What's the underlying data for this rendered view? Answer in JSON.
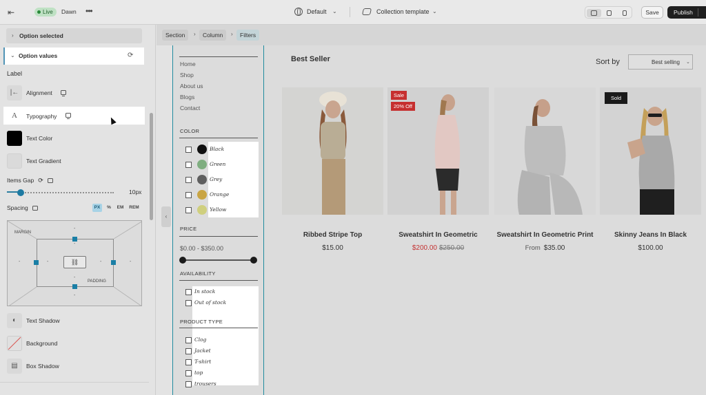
{
  "topbar": {
    "status_badge": "Live",
    "theme_name": "Dawn",
    "locale": "Default",
    "template": "Collection template",
    "save_label": "Save",
    "publish_label": "Publish",
    "icons": [
      "exit-icon",
      "more-icon",
      "globe-icon",
      "template-icon",
      "desktop-icon",
      "tablet-icon",
      "mobile-icon"
    ]
  },
  "sidebar": {
    "collapsed_section": "Option selected",
    "active_section": "Option values",
    "group_label": "Label",
    "properties": [
      {
        "label": "Alignment",
        "icon": "align-left-icon"
      },
      {
        "label": "Typography",
        "icon": "typography-icon"
      },
      {
        "label": "Text Color",
        "icon": "color-swatch"
      },
      {
        "label": "Text Gradient",
        "icon": "gradient-swatch"
      }
    ],
    "items_gap": {
      "label": "Items Gap",
      "value": "10px",
      "level": 0.1
    },
    "spacing": {
      "label": "Spacing",
      "units": [
        "PX",
        "%",
        "EM",
        "REM"
      ],
      "selected_unit": "PX",
      "margin_label": "MARGIN",
      "padding_label": "PADDING",
      "placeholder": "-"
    },
    "more_properties": [
      {
        "label": "Text Shadow",
        "icon": "shadow-icon"
      },
      {
        "label": "Background",
        "icon": "background-swatch"
      },
      {
        "label": "Box Shadow",
        "icon": "box-shadow-icon"
      }
    ],
    "colors": {
      "accent": "#1d7aa2",
      "text_color_swatch": "#000000"
    }
  },
  "breadcrumb": [
    "Section",
    "Column",
    "Filters"
  ],
  "filters": {
    "nav_links": [
      "Home",
      "Shop",
      "About us",
      "Blogs",
      "Contact"
    ],
    "color": {
      "heading": "COLOR",
      "options": [
        {
          "label": "Black",
          "swatch": "#111111"
        },
        {
          "label": "Green",
          "swatch": "#7fae80"
        },
        {
          "label": "Grey",
          "swatch": "#5f5f5f"
        },
        {
          "label": "Orange",
          "swatch": "#c9a544"
        },
        {
          "label": "Yellow",
          "swatch": "#cfcf7e"
        }
      ]
    },
    "price": {
      "heading": "PRICE",
      "range_text": "$0.00 - $350.00"
    },
    "availability": {
      "heading": "AVAILABILITY",
      "options": [
        "In stock",
        "Out of stock"
      ]
    },
    "product_type": {
      "heading": "PRODUCT TYPE",
      "options": [
        "Clog",
        "Jacket",
        "T-shirt",
        "top",
        "trousers"
      ]
    }
  },
  "collection": {
    "title": "Best Seller",
    "sort_label": "Sort by",
    "sort_value": "Best selling",
    "products": [
      {
        "title": "Ribbed Stripe Top",
        "price": "$15.00",
        "badges": []
      },
      {
        "title": "Sweatshirt In Geometric",
        "price": "$200.00",
        "compare_at": "$250.00",
        "badges": [
          "Sale",
          "20% Off"
        ]
      },
      {
        "title": "Sweatshirt In Geometric Print",
        "price_prefix": "From",
        "price": "$35.00",
        "badges": []
      },
      {
        "title": "Skinny Jeans In Black",
        "price": "$100.00",
        "badges": [
          "Sold"
        ]
      }
    ]
  }
}
